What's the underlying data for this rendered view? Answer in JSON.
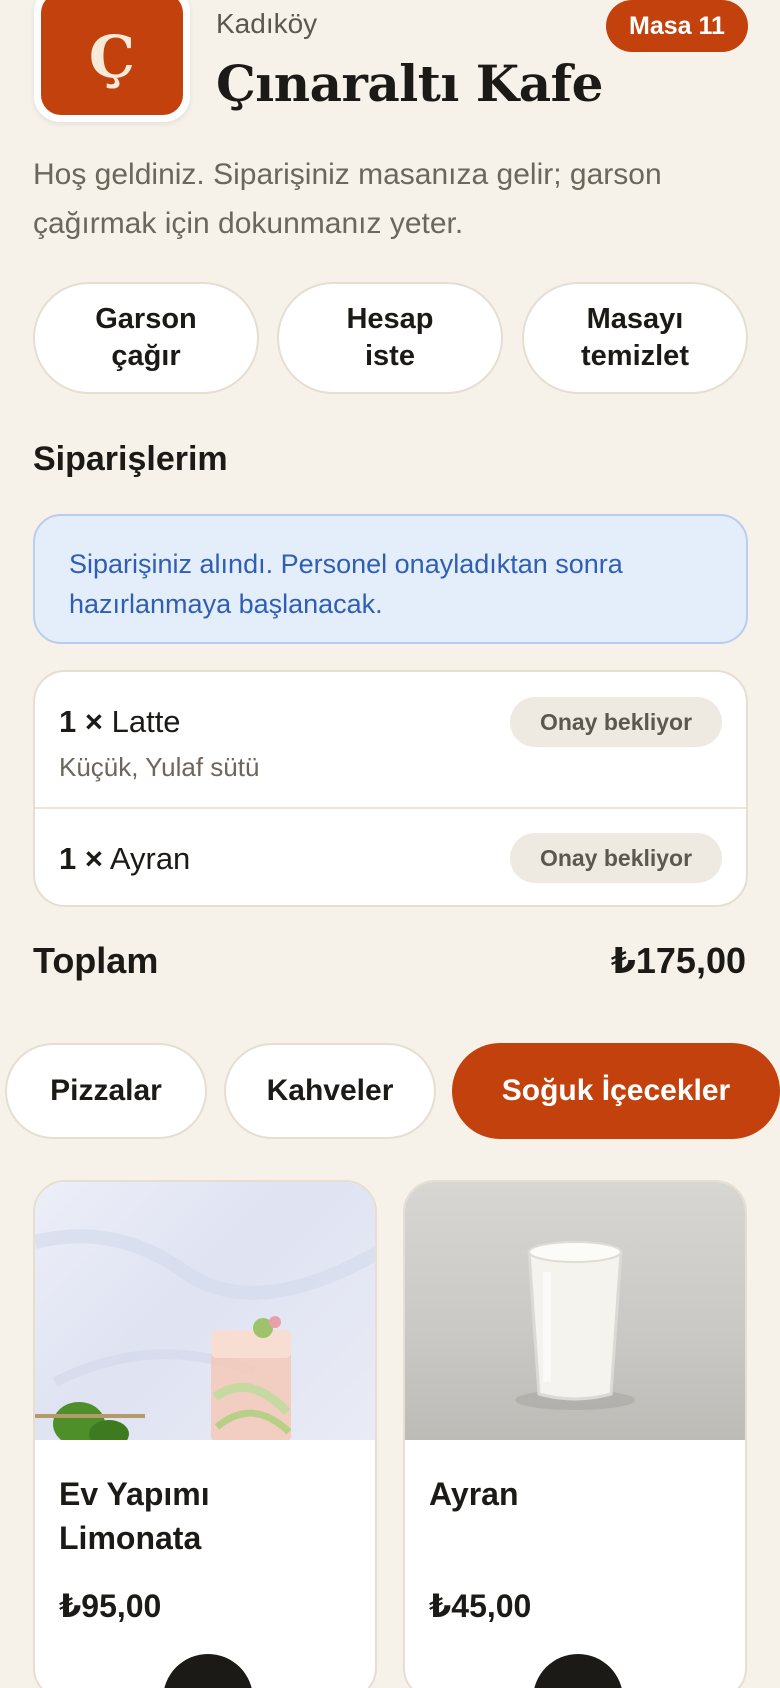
{
  "header": {
    "logo_letter": "Ç",
    "district": "Kadıköy",
    "cafe_name": "Çınaraltı Kafe",
    "table_badge": "Masa 11"
  },
  "welcome_text": "Hoş geldiniz. Siparişiniz masanıza gelir; garson çağırmak için dokunmanız yeter.",
  "actions": [
    {
      "label": "Garson çağır"
    },
    {
      "label": "Hesap iste"
    },
    {
      "label": "Masayı temizlet"
    }
  ],
  "orders_section": {
    "title": "Siparişlerim",
    "notice": "Siparişiniz alındı. Personel onayladıktan sonra hazırlanmaya başlanacak.",
    "items": [
      {
        "qty": "1 ×",
        "name": "Latte",
        "options": "Küçük, Yulaf sütü",
        "status": "Onay bekliyor"
      },
      {
        "qty": "1 ×",
        "name": "Ayran",
        "options": "",
        "status": "Onay bekliyor"
      }
    ],
    "total_label": "Toplam",
    "total_value": "₺175,00"
  },
  "categories": [
    {
      "label": "Pizzalar",
      "active": false
    },
    {
      "label": "Kahveler",
      "active": false
    },
    {
      "label": "Soğuk İçecekler",
      "active": true
    }
  ],
  "products": [
    {
      "name": "Ev Yapımı Limonata",
      "price": "₺95,00",
      "image": "lemonade-photo"
    },
    {
      "name": "Ayran",
      "price": "₺45,00",
      "image": "ayran-photo"
    }
  ],
  "colors": {
    "accent": "#c2410c",
    "background": "#f6f2ea",
    "notice_bg": "#e4edfa",
    "notice_text": "#2f5fb2"
  }
}
